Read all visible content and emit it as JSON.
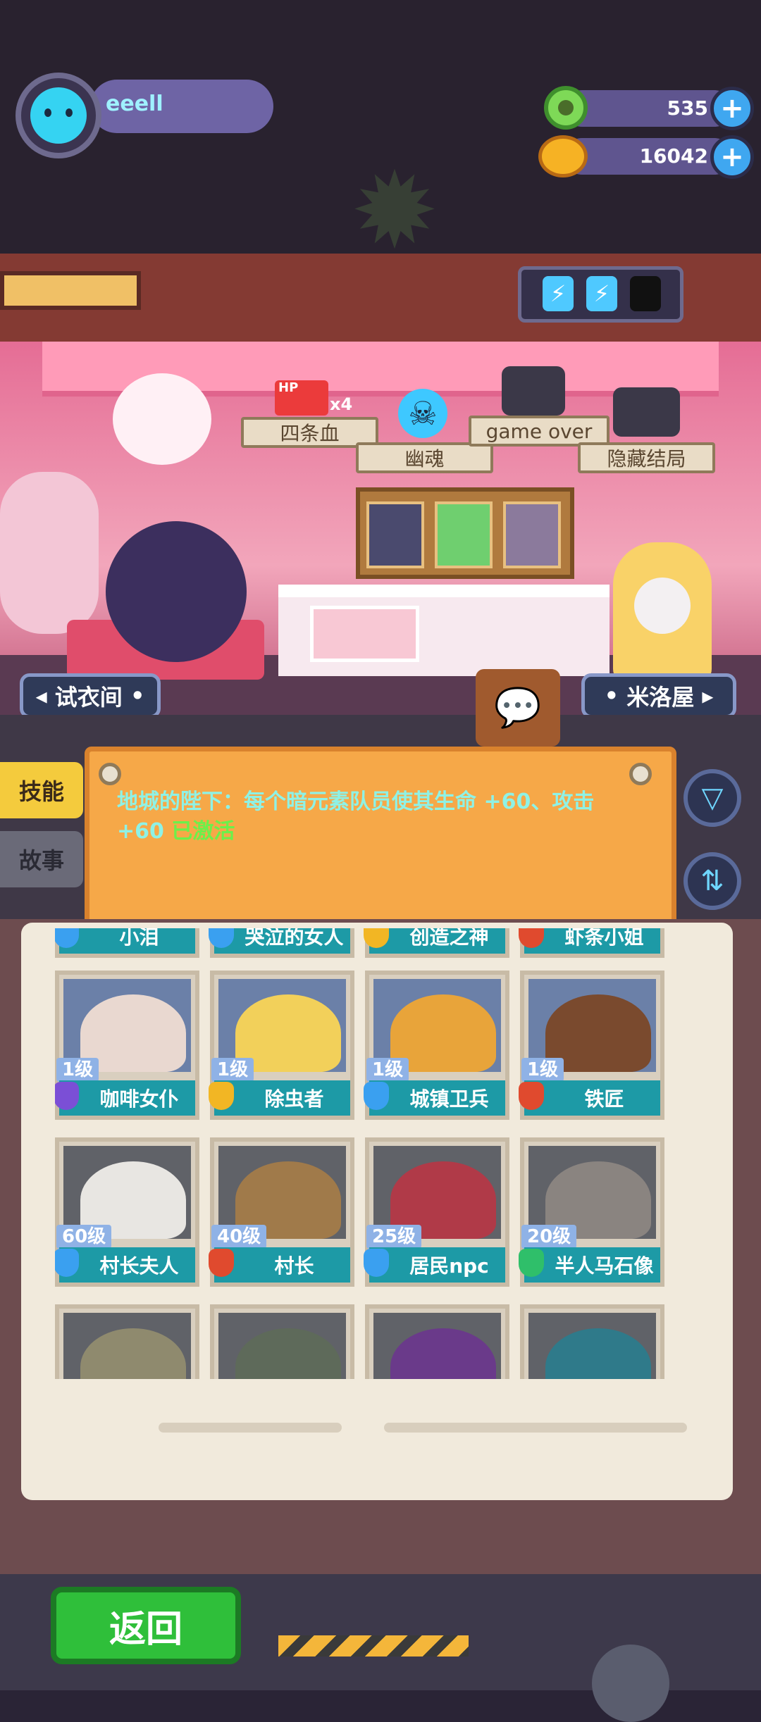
{
  "player": {
    "name": "eeell"
  },
  "resources": {
    "donuts": "535",
    "coins": "16042"
  },
  "room_tags": {
    "hp_badge": "HP",
    "hp_mult": "x4",
    "four_bars": "四条血",
    "ghost": "幽魂",
    "game_over": "game over",
    "hidden_end": "隐藏结局"
  },
  "nav": {
    "left": "试衣间",
    "right": "米洛屋"
  },
  "side_tabs": {
    "skill": "技能",
    "story": "故事"
  },
  "skill": {
    "text": "地城的陛下：每个暗元素队员使其生命 +60、攻击 +60 ",
    "status": "已激活"
  },
  "cards_partial": [
    "小泪",
    "哭泣的女人",
    "创造之神",
    "虾条小姐"
  ],
  "cards": [
    [
      {
        "level": "1级",
        "name": "咖啡女仆",
        "badge": "purple"
      },
      {
        "level": "1级",
        "name": "除虫者",
        "badge": "gold"
      },
      {
        "level": "1级",
        "name": "城镇卫兵",
        "badge": "blue"
      },
      {
        "level": "1级",
        "name": "铁匠",
        "badge": "red"
      }
    ],
    [
      {
        "level": "60级",
        "name": "村长夫人",
        "badge": "blue"
      },
      {
        "level": "40级",
        "name": "村长",
        "badge": "red"
      },
      {
        "level": "25级",
        "name": "居民npc",
        "badge": "blue"
      },
      {
        "level": "20级",
        "name": "半人马石像",
        "badge": "green"
      }
    ]
  ],
  "footer": {
    "back": "返回"
  },
  "colors": {
    "accent_teal": "#1d9aa6",
    "board_orange": "#f6a848",
    "skill_text": "#8ef2e6",
    "active_green": "#6cf04a"
  }
}
